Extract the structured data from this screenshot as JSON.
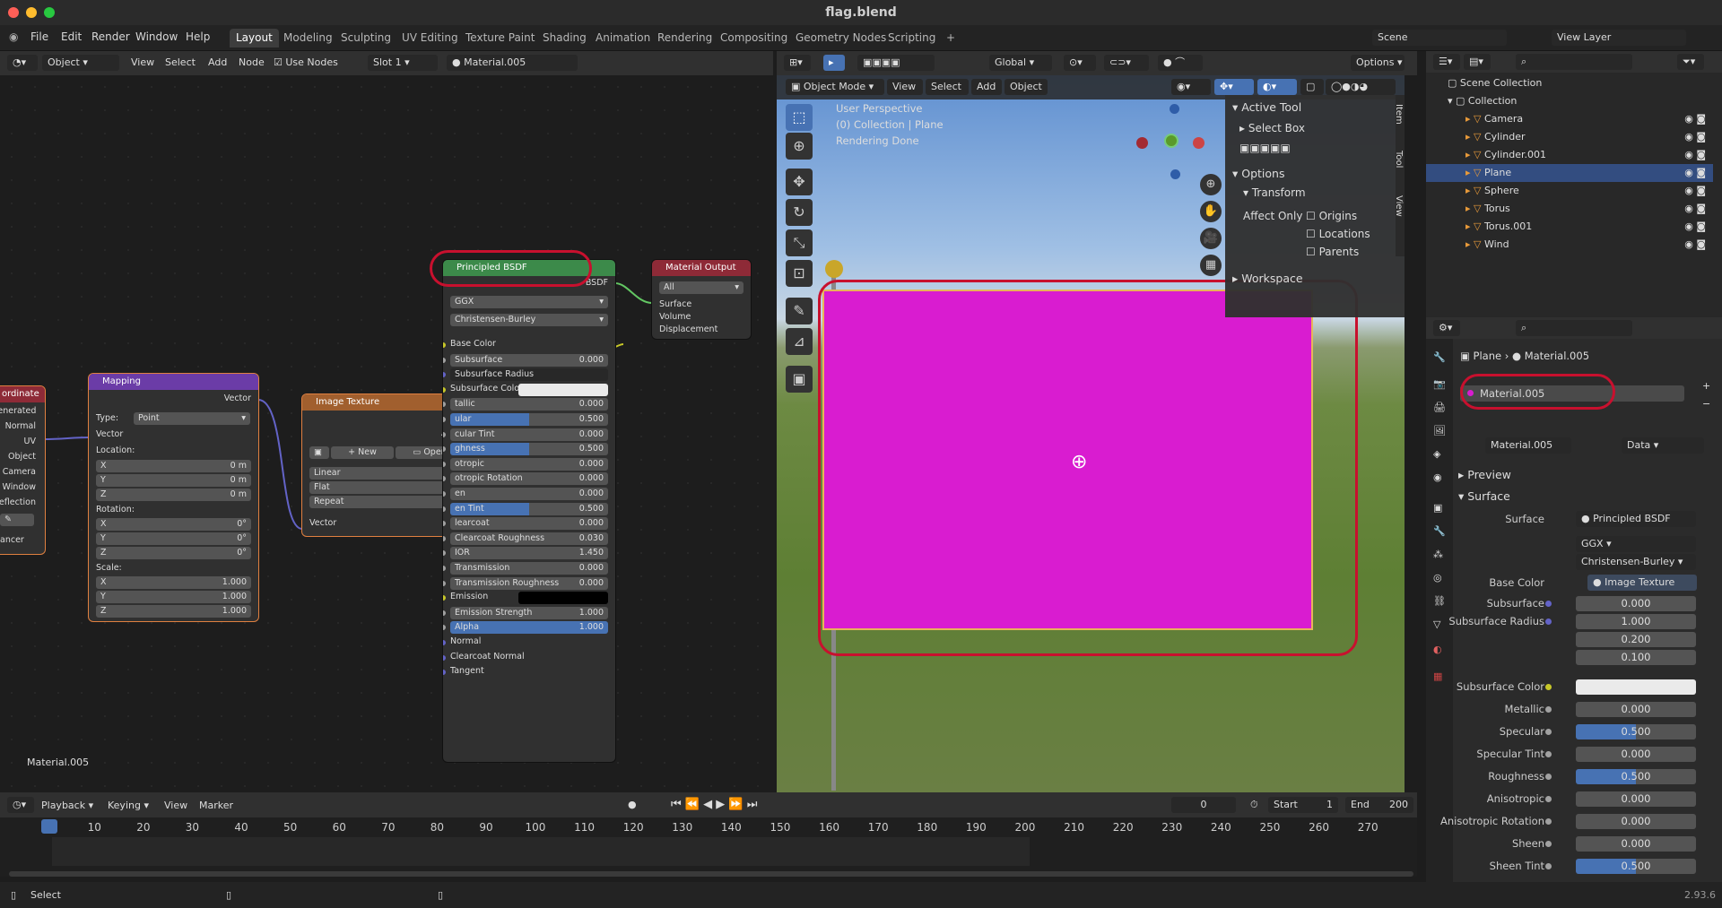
{
  "window": {
    "title": "flag.blend"
  },
  "menu": {
    "items": [
      "File",
      "Edit",
      "Render",
      "Window",
      "Help"
    ]
  },
  "workspaces": {
    "tabs": [
      "Layout",
      "Modeling",
      "Sculpting",
      "UV Editing",
      "Texture Paint",
      "Shading",
      "Animation",
      "Rendering",
      "Compositing",
      "Geometry Nodes",
      "Scripting"
    ],
    "active": "Layout"
  },
  "scene": {
    "name": "Scene",
    "view_layer": "View Layer"
  },
  "node_header": {
    "mode": "Object",
    "menus": [
      "View",
      "Select",
      "Add",
      "Node"
    ],
    "use_nodes": "Use Nodes",
    "slot": "Slot 1",
    "material": "Material.005"
  },
  "node_editor": {
    "footer_material": "Material.005"
  },
  "tex_coord": {
    "title": "ordinate",
    "outputs": [
      "Generated",
      "Normal",
      "UV",
      "Object",
      "Camera",
      "Window",
      "Reflection"
    ],
    "bottom": "ancer"
  },
  "mapping": {
    "title": "Mapping",
    "out": "Vector",
    "type_label": "Type:",
    "type": "Point",
    "vector": "Vector",
    "location": "Location:",
    "rotation": "Rotation:",
    "scale": "Scale:",
    "loc": [
      [
        "X",
        "0 m"
      ],
      [
        "Y",
        "0 m"
      ],
      [
        "Z",
        "0 m"
      ]
    ],
    "rot": [
      [
        "X",
        "0°"
      ],
      [
        "Y",
        "0°"
      ],
      [
        "Z",
        "0°"
      ]
    ],
    "scl": [
      [
        "X",
        "1.000"
      ],
      [
        "Y",
        "1.000"
      ],
      [
        "Z",
        "1.000"
      ]
    ]
  },
  "image_texture": {
    "title": "Image Texture",
    "outputs": [
      "Color",
      "Alpha"
    ],
    "new": "New",
    "open": "Open",
    "interp": "Linear",
    "proj": "Flat",
    "ext": "Repeat",
    "input": "Vector"
  },
  "principled": {
    "title": "Principled BSDF",
    "out": "BSDF",
    "dist": "GGX",
    "sss": "Christensen-Burley",
    "rows": [
      [
        "Base Color",
        ""
      ],
      [
        "Subsurface",
        "0.000"
      ],
      [
        "Subsurface Radius",
        ""
      ],
      [
        "Subsurface Colo",
        ""
      ],
      [
        "tallic",
        "0.000"
      ],
      [
        "ular",
        "0.500"
      ],
      [
        "cular Tint",
        "0.000"
      ],
      [
        "ghness",
        "0.500"
      ],
      [
        "otropic",
        "0.000"
      ],
      [
        "otropic Rotation",
        "0.000"
      ],
      [
        "en",
        "0.000"
      ],
      [
        "en Tint",
        "0.500"
      ],
      [
        "learcoat",
        "0.000"
      ],
      [
        "Clearcoat Roughness",
        "0.030"
      ],
      [
        "IOR",
        "1.450"
      ],
      [
        "Transmission",
        "0.000"
      ],
      [
        "Transmission Roughness",
        "0.000"
      ],
      [
        "Emission",
        ""
      ],
      [
        "Emission Strength",
        "1.000"
      ],
      [
        "Alpha",
        "1.000"
      ],
      [
        "Normal",
        ""
      ],
      [
        "Clearcoat Normal",
        ""
      ],
      [
        "Tangent",
        ""
      ]
    ]
  },
  "material_output": {
    "title": "Material Output",
    "target": "All",
    "inputs": [
      "Surface",
      "Volume",
      "Displacement"
    ]
  },
  "viewport": {
    "mode": "Object Mode",
    "menus": [
      "View",
      "Select",
      "Add",
      "Object"
    ],
    "transform": "Global",
    "options": "Options",
    "info": [
      "User Perspective",
      "(0) Collection | Plane",
      "Rendering Done"
    ]
  },
  "npanel": {
    "active_tool": "Active Tool",
    "tool": "Select Box",
    "options": "Options",
    "transform": "Transform",
    "affect_only": "Affect Only",
    "affects": [
      "Origins",
      "Locations",
      "Parents"
    ],
    "workspace": "Workspace",
    "tabs": [
      "Item",
      "Tool",
      "View"
    ]
  },
  "outliner": {
    "root": "Scene Collection",
    "collection": "Collection",
    "items": [
      "Camera",
      "Cylinder",
      "Cylinder.001",
      "Plane",
      "Sphere",
      "Torus",
      "Torus.001",
      "Wind"
    ],
    "selected": "Plane"
  },
  "properties": {
    "breadcrumb_obj": "Plane",
    "breadcrumb_mat": "Material.005",
    "slot": "Material.005",
    "material": "Material.005",
    "link": "Data",
    "preview": "Preview",
    "surface_panel": "Surface",
    "surface_label": "Surface",
    "surface_val": "Principled BSDF",
    "dist": "GGX",
    "sss": "Christensen-Burley",
    "base_color": "Base Color",
    "base_val": "Image Texture",
    "rows": [
      [
        "Subsurface",
        "0.000"
      ],
      [
        "Subsurface Radius",
        "1.000"
      ],
      [
        "",
        "0.200"
      ],
      [
        "",
        "0.100"
      ],
      [
        "Subsurface Color",
        ""
      ],
      [
        "Metallic",
        "0.000"
      ],
      [
        "Specular",
        "0.500"
      ],
      [
        "Specular Tint",
        "0.000"
      ],
      [
        "Roughness",
        "0.500"
      ],
      [
        "Anisotropic",
        "0.000"
      ],
      [
        "Anisotropic Rotation",
        "0.000"
      ],
      [
        "Sheen",
        "0.000"
      ],
      [
        "Sheen Tint",
        "0.500"
      ]
    ]
  },
  "timeline": {
    "menus": [
      "Playback",
      "Keying",
      "View",
      "Marker"
    ],
    "current": "0",
    "start_label": "Start",
    "start": "1",
    "end_label": "End",
    "end": "200",
    "ticks": [
      "0",
      "10",
      "20",
      "30",
      "40",
      "50",
      "60",
      "70",
      "80",
      "90",
      "100",
      "110",
      "120",
      "130",
      "140",
      "150",
      "160",
      "170",
      "180",
      "190",
      "200",
      "210",
      "220",
      "230",
      "240",
      "250",
      "260",
      "270"
    ]
  },
  "status": {
    "left": "Select",
    "version": "2.93.6"
  }
}
